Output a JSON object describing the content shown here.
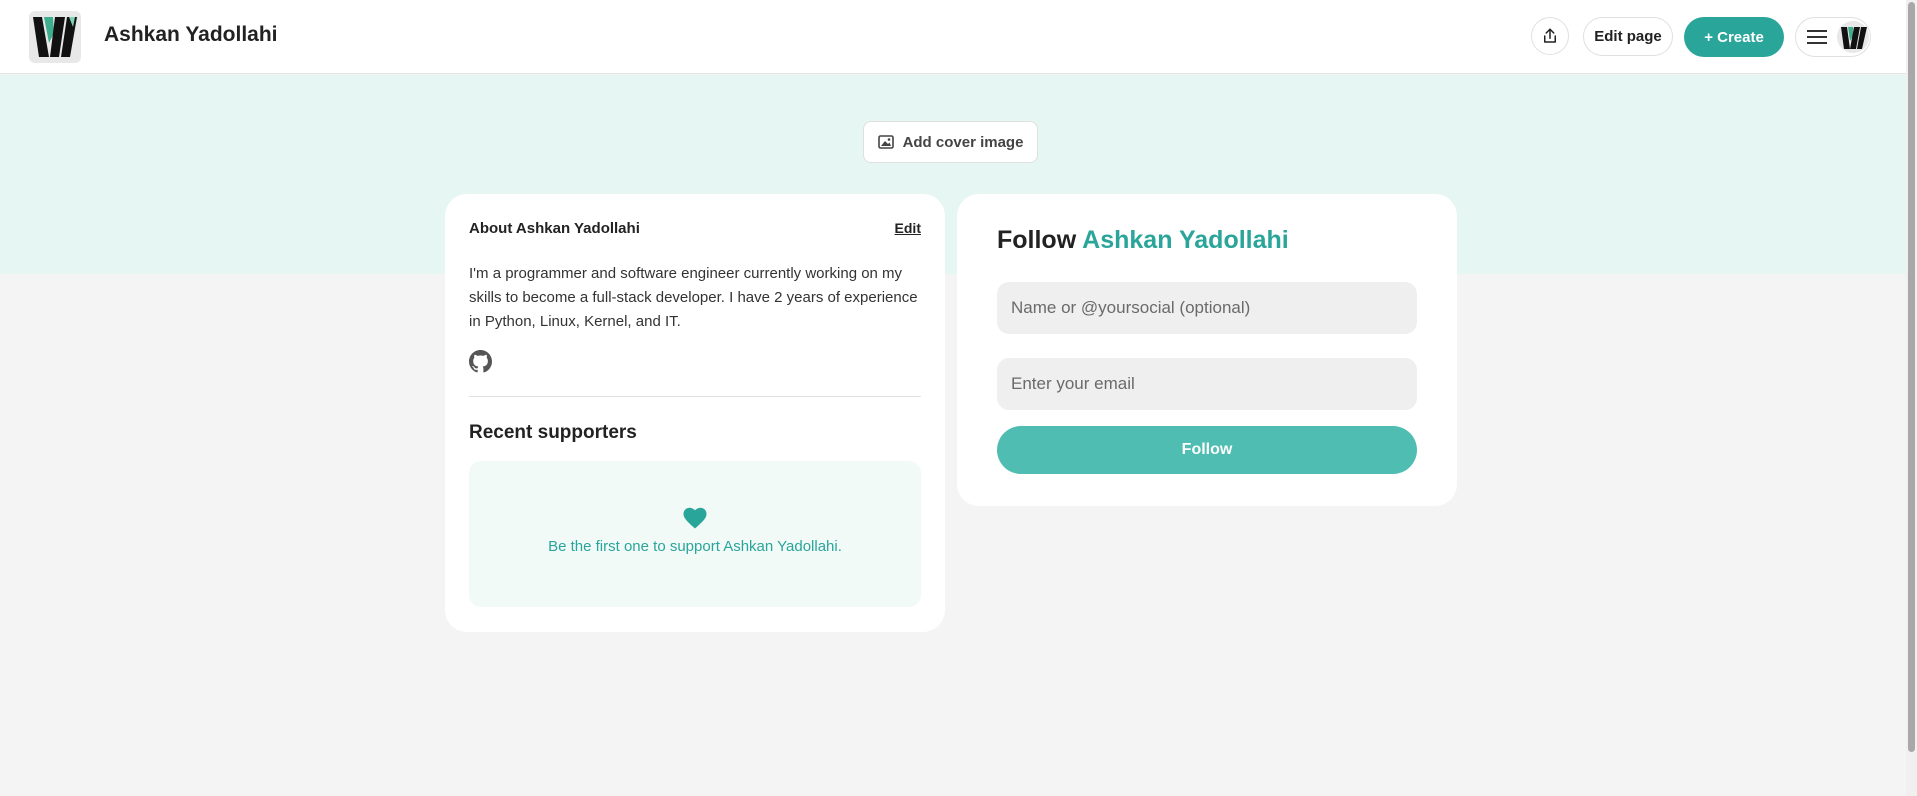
{
  "header": {
    "title": "Ashkan Yadollahi",
    "edit_label": "Edit page",
    "create_label": "+ Create",
    "accent_color": "#2aa59a"
  },
  "icons": {
    "logo": "logo-icon",
    "share": "share-icon",
    "menu": "hamburger-menu-icon",
    "avatar": "avatar-icon",
    "cover": "image-icon",
    "github": "github-icon",
    "heart": "heart-icon"
  },
  "cover": {
    "button_label": "Add cover image"
  },
  "about": {
    "heading": "About Ashkan Yadollahi",
    "edit_label": "Edit",
    "bio": "I'm a programmer and software engineer currently working on my skills to become a full-stack developer. I have 2 years of experience in Python, Linux, Kernel, and IT."
  },
  "supporters": {
    "heading": "Recent supporters",
    "empty_text": "Be the first one to support Ashkan Yadollahi."
  },
  "follow": {
    "title_prefix": "Follow ",
    "title_name": "Ashkan Yadollahi",
    "name_placeholder": "Name or @yoursocial (optional)",
    "email_placeholder": "Enter your email",
    "button_label": "Follow"
  }
}
